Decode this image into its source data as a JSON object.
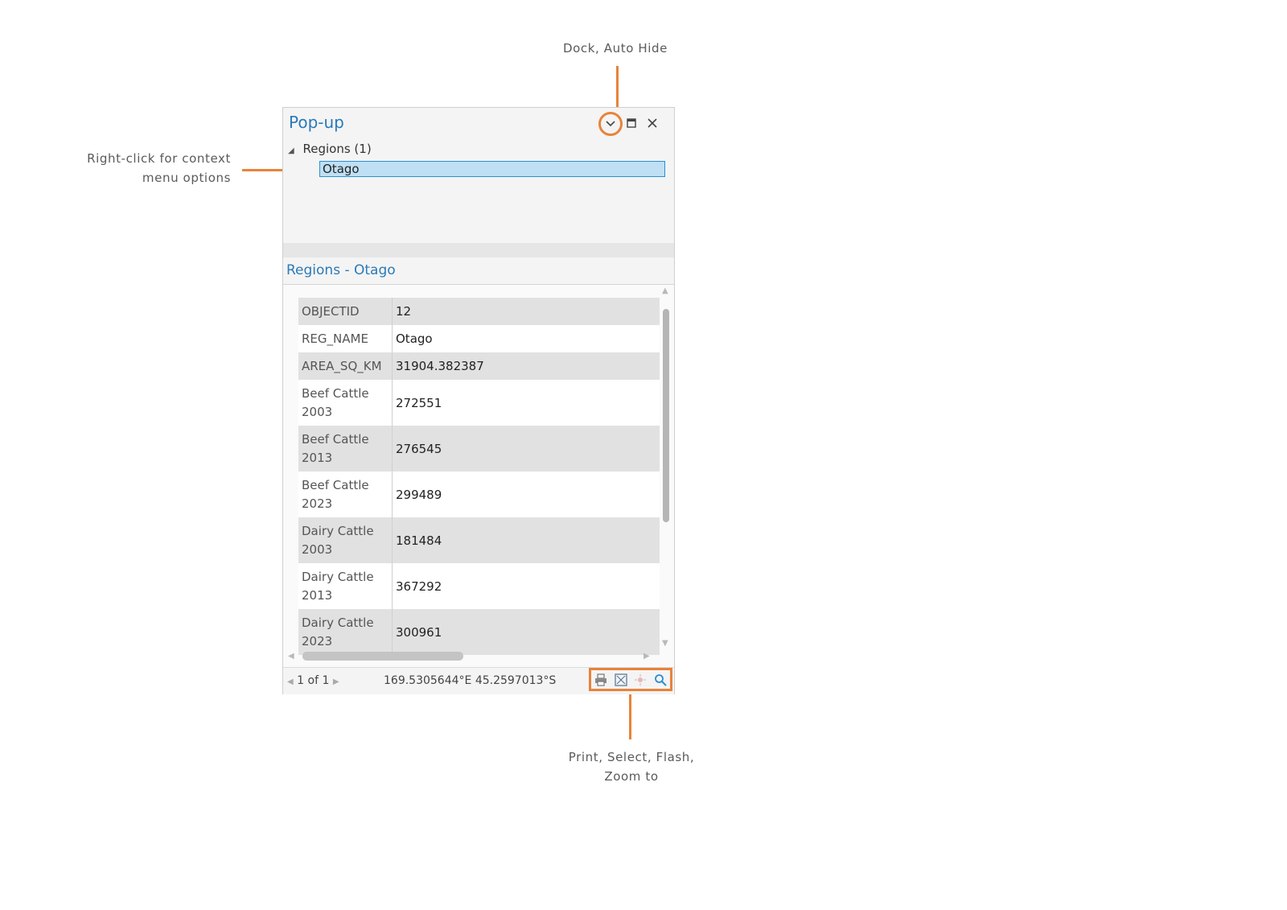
{
  "callouts": {
    "dock": "Dock, Auto Hide",
    "context_line1": "Right-click for context",
    "context_line2": "menu options",
    "tools_line1": "Print, Select, Flash,",
    "tools_line2": "Zoom to"
  },
  "pane": {
    "title": "Pop-up",
    "tree": {
      "group_label": "Regions (1)",
      "selected_item": "Otago"
    },
    "detail_title": "Regions - Otago",
    "rows": [
      {
        "field": "OBJECTID",
        "value": "12"
      },
      {
        "field": "REG_NAME",
        "value": "Otago"
      },
      {
        "field": "AREA_SQ_KM",
        "value": "31904.382387"
      },
      {
        "field": "Beef Cattle 2003",
        "value": "272551"
      },
      {
        "field": "Beef Cattle 2013",
        "value": "276545"
      },
      {
        "field": "Beef Cattle 2023",
        "value": "299489"
      },
      {
        "field": "Dairy Cattle 2003",
        "value": "181484"
      },
      {
        "field": "Dairy Cattle 2013",
        "value": "367292"
      },
      {
        "field": "Dairy Cattle 2023",
        "value": "300961"
      }
    ],
    "footer": {
      "page_indicator": "1 of 1",
      "coordinates": "169.5305644°E 45.2597013°S"
    },
    "icons": {
      "dropdown": "chevron-down-icon",
      "maximize": "maximize-icon",
      "close": "close-icon",
      "print": "print-icon",
      "select": "select-icon",
      "flash": "flash-icon",
      "zoom": "zoom-to-icon"
    }
  },
  "colors": {
    "accent_orange": "#e8833a",
    "title_blue": "#2a7ab8",
    "selection_fill": "#bfe0f4",
    "selection_border": "#2a8fd1"
  }
}
